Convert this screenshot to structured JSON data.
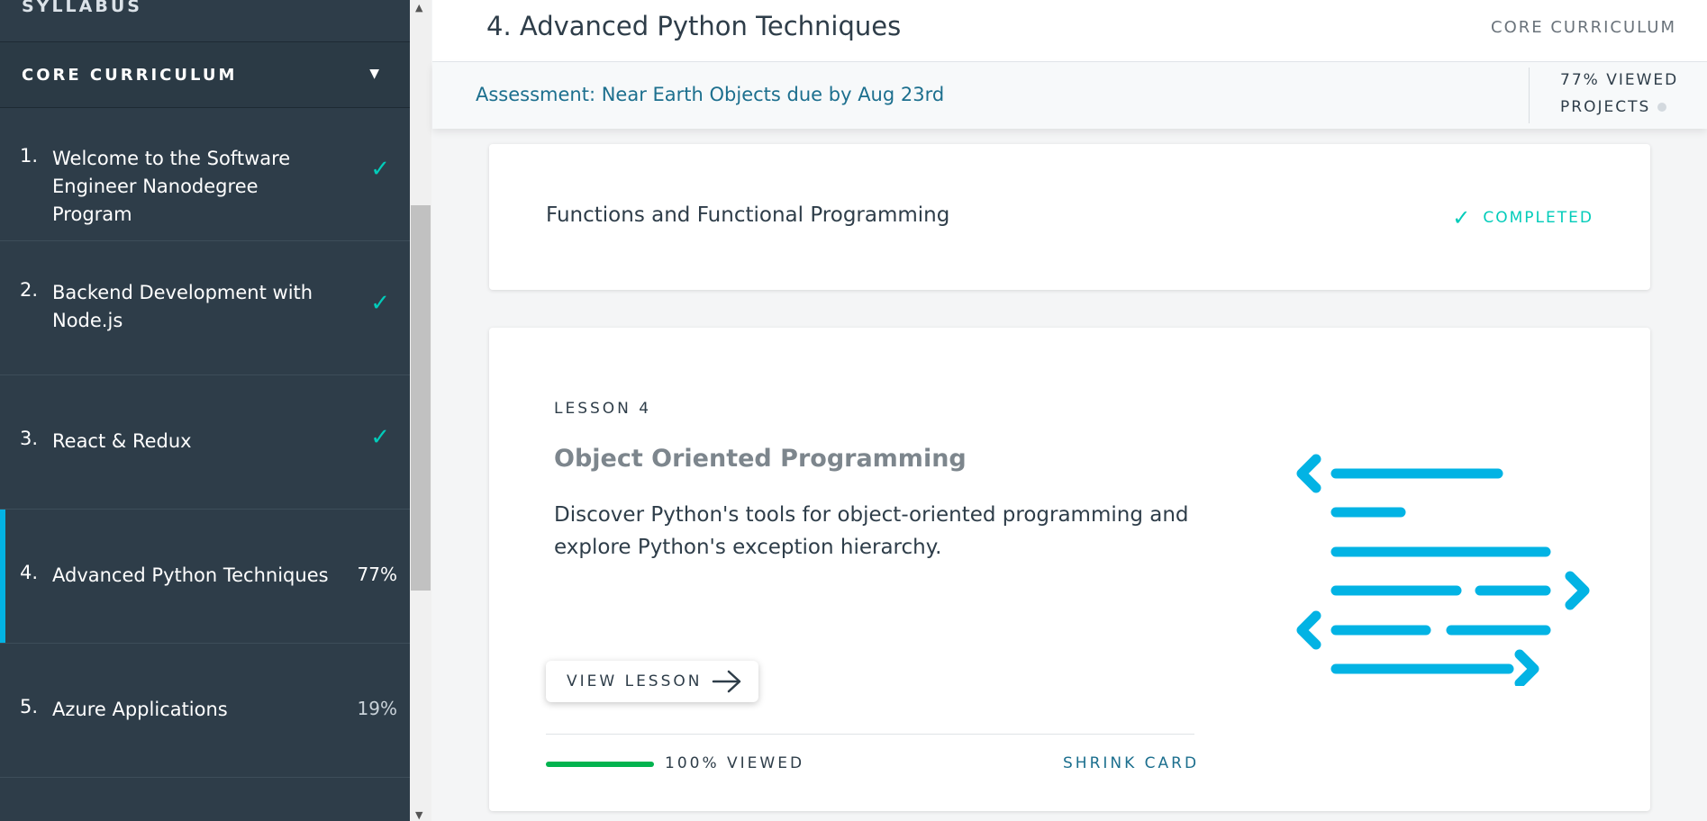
{
  "sidebar": {
    "syllabus_label": "SYLLABUS",
    "curriculum_label": "CORE CURRICULUM",
    "items": [
      {
        "num": "1.",
        "title": "Welcome to the Software Engineer Nanodegree Program",
        "status": "✓"
      },
      {
        "num": "2.",
        "title": "Backend Development with Node.js",
        "status": "✓"
      },
      {
        "num": "3.",
        "title": "React & Redux",
        "status": "✓"
      },
      {
        "num": "4.",
        "title": "Advanced Python Techniques",
        "status": "77%"
      },
      {
        "num": "5.",
        "title": "Azure Applications",
        "status": "19%"
      }
    ]
  },
  "header": {
    "title": "4. Advanced Python Techniques",
    "right_label": "CORE CURRICULUM"
  },
  "subbar": {
    "assessment": "Assessment: Near Earth Objects due by Aug 23rd",
    "viewed": "77% VIEWED",
    "projects": "PROJECTS"
  },
  "cards": {
    "completed_card": {
      "title": "Functions and Functional Programming",
      "status": "COMPLETED"
    },
    "lesson_card": {
      "tag": "LESSON 4",
      "title": "Object Oriented Programming",
      "description": "Discover Python's tools for object-oriented programming and explore Python's exception hierarchy.",
      "button_label": "VIEW LESSON",
      "viewed_label": "100% VIEWED",
      "progress": 1.0,
      "shrink_label": "SHRINK CARD"
    }
  },
  "colors": {
    "sidebar_bg": "#2e3d49",
    "accent_cyan": "#02b3e4",
    "check_green": "#02ccba",
    "progress_green": "#02b34f",
    "link_teal": "#1c6f8e"
  },
  "icons": {
    "check": "check-icon",
    "caret": "caret-down-icon",
    "arrow": "arrow-right-icon",
    "illustration": "code-lines-illustration"
  }
}
